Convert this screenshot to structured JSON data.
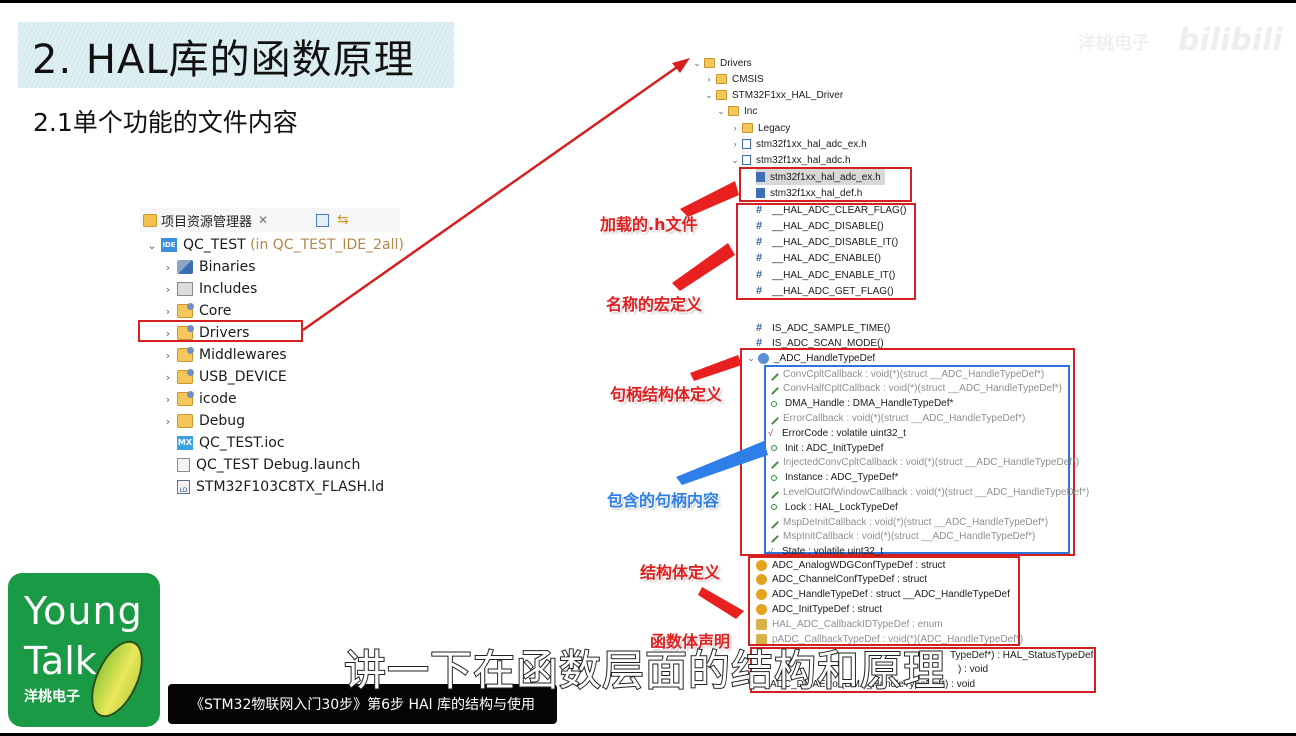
{
  "slide": {
    "title": "2. HAL库的函数原理",
    "subtitle": "2.1单个功能的文件内容"
  },
  "watermark": {
    "text": "洋桃电子",
    "logo": "bilibili"
  },
  "explorer": {
    "header": {
      "title": "项目资源管理器",
      "close_icon": "✕",
      "collapse_icon": "collapse-all-icon",
      "link_icon": "link-with-editor-icon"
    },
    "project": {
      "name": "QC_TEST",
      "location": "(in QC_TEST_IDE_2all)",
      "icon": "IDE"
    },
    "items": [
      {
        "label": "Binaries",
        "icon": "binaries-icon",
        "expandable": true
      },
      {
        "label": "Includes",
        "icon": "includes-icon",
        "expandable": true
      },
      {
        "label": "Core",
        "icon": "source-folder-icon",
        "expandable": true
      },
      {
        "label": "Drivers",
        "icon": "source-folder-icon",
        "expandable": true,
        "highlighted": true
      },
      {
        "label": "Middlewares",
        "icon": "source-folder-icon",
        "expandable": true
      },
      {
        "label": "USB_DEVICE",
        "icon": "source-folder-icon",
        "expandable": true
      },
      {
        "label": "icode",
        "icon": "source-folder-icon",
        "expandable": true
      },
      {
        "label": "Debug",
        "icon": "folder-icon",
        "expandable": true
      },
      {
        "label": "QC_TEST.ioc",
        "icon": "mx-icon",
        "expandable": false
      },
      {
        "label": "QC_TEST Debug.launch",
        "icon": "file-icon",
        "expandable": false
      },
      {
        "label": "STM32F103C8TX_FLASH.ld",
        "icon": "linker-file-icon",
        "expandable": false
      }
    ]
  },
  "outline": {
    "tree": [
      {
        "label": "Drivers",
        "chevron": "v"
      },
      {
        "label": "CMSIS",
        "chevron": ">"
      },
      {
        "label": "STM32F1xx_HAL_Driver",
        "chevron": "v"
      },
      {
        "label": "Inc",
        "chevron": "v"
      },
      {
        "label": "Legacy",
        "chevron": ">"
      },
      {
        "label": "stm32f1xx_hal_adc_ex.h",
        "chevron": ">"
      },
      {
        "label": "stm32f1xx_hal_adc.h",
        "chevron": "v"
      }
    ],
    "includes": [
      "stm32f1xx_hal_adc_ex.h",
      "stm32f1xx_hal_def.h"
    ],
    "macros": [
      "__HAL_ADC_CLEAR_FLAG()",
      "__HAL_ADC_DISABLE()",
      "__HAL_ADC_DISABLE_IT()",
      "__HAL_ADC_ENABLE()",
      "__HAL_ADC_ENABLE_IT()",
      "__HAL_ADC_GET_FLAG()"
    ],
    "other_macros": [
      "IS_ADC_SAMPLE_TIME()",
      "IS_ADC_SCAN_MODE()"
    ],
    "handle_struct": "_ADC_HandleTypeDef",
    "handle_fields": [
      {
        "label": "ConvCpltCallback : void(*)(struct __ADC_HandleTypeDef*)",
        "kind": "callback"
      },
      {
        "label": "ConvHalfCpltCallback : void(*)(struct __ADC_HandleTypeDef*)",
        "kind": "callback"
      },
      {
        "label": "DMA_Handle : DMA_HandleTypeDef*",
        "kind": "public"
      },
      {
        "label": "ErrorCallback : void(*)(struct __ADC_HandleTypeDef*)",
        "kind": "callback"
      },
      {
        "label": "ErrorCode : volatile uint32_t",
        "kind": "volatile"
      },
      {
        "label": "Init : ADC_InitTypeDef",
        "kind": "public"
      },
      {
        "label": "InjectedConvCpltCallback : void(*)(struct __ADC_HandleTypeDef*)",
        "kind": "callback"
      },
      {
        "label": "Instance : ADC_TypeDef*",
        "kind": "public"
      },
      {
        "label": "LevelOutOfWindowCallback : void(*)(struct __ADC_HandleTypeDef*)",
        "kind": "callback"
      },
      {
        "label": "Lock : HAL_LockTypeDef",
        "kind": "public"
      },
      {
        "label": "MspDeInitCallback : void(*)(struct __ADC_HandleTypeDef*)",
        "kind": "callback"
      },
      {
        "label": "MspInitCallback : void(*)(struct __ADC_HandleTypeDef*)",
        "kind": "callback"
      },
      {
        "label": "State : volatile uint32_t",
        "kind": "volatile"
      }
    ],
    "typedefs": [
      {
        "label": "ADC_AnalogWDGConfTypeDef : struct",
        "kind": "typedef"
      },
      {
        "label": "ADC_ChannelConfTypeDef : struct",
        "kind": "typedef"
      },
      {
        "label": "ADC_HandleTypeDef : struct __ADC_HandleTypeDef",
        "kind": "typedef"
      },
      {
        "label": "ADC_InitTypeDef : struct",
        "kind": "typedef"
      },
      {
        "label": "HAL_ADC_CallbackIDTypeDef : enum",
        "kind": "enum"
      },
      {
        "label": "pADC_CallbackTypeDef : void(*)(ADC_HandleTypeDef*)",
        "kind": "enum"
      }
    ],
    "functions": [
      "TypeDef*) : HAL_StatusTypeDef",
      ") : void",
      "ADC_DMAError(DMA_HandleTypeDef*) : void"
    ]
  },
  "annotations": {
    "include_label": "加载的.h文件",
    "macro_label": "名称的宏定义",
    "handle_struct_label": "句柄结构体定义",
    "handle_content_label": "包含的句柄内容",
    "struct_label": "结构体定义",
    "function_label": "函数体声明"
  },
  "logo": {
    "line1": "Young",
    "line2": "Talk",
    "brand": "洋桃电子"
  },
  "captions": {
    "series_title": "《STM32物联网入门30步》第6步 HAl 库的结构与使用",
    "subtitle": "讲一下在函数层面的结构和原理"
  },
  "colors": {
    "annotation_red": "#e02020",
    "annotation_blue": "#2e7fe8",
    "logo_green": "#1a9a44",
    "title_banner": "#dff0f3"
  }
}
